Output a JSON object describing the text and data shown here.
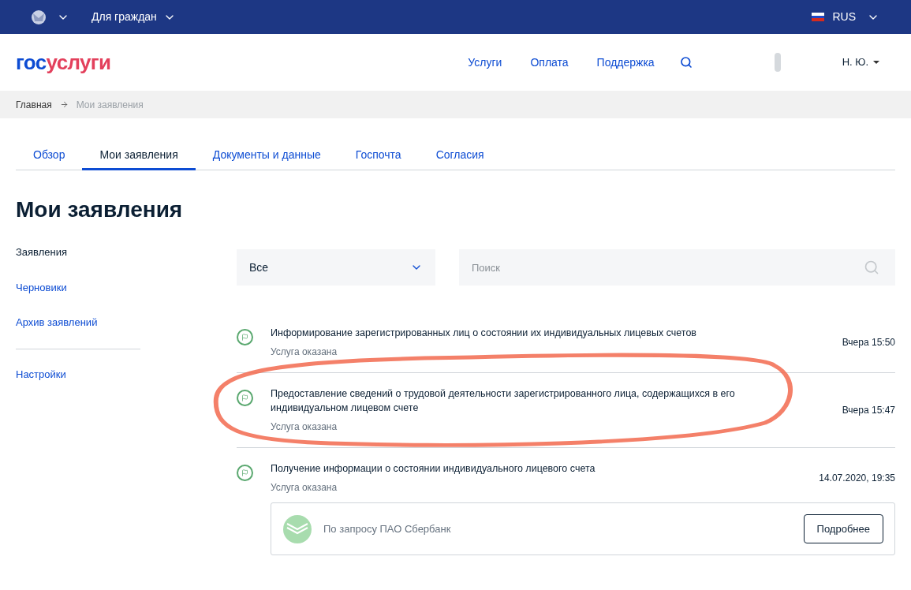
{
  "top_bar": {
    "audience": "Для граждан",
    "language": "RUS"
  },
  "header": {
    "logo": {
      "prefix": "гос",
      "suffix": "услуги"
    },
    "nav": [
      "Услуги",
      "Оплата",
      "Поддержка"
    ],
    "user": "Н. Ю."
  },
  "breadcrumbs": [
    {
      "label": "Главная"
    },
    {
      "label": "Мои заявления"
    }
  ],
  "tabs": [
    {
      "label": "Обзор",
      "selected": false
    },
    {
      "label": "Мои заявления",
      "selected": true
    },
    {
      "label": "Документы и данные",
      "selected": false
    },
    {
      "label": "Госпочта",
      "selected": false
    },
    {
      "label": "Согласия",
      "selected": false
    }
  ],
  "page_title": "Мои заявления",
  "sidebar": {
    "items": [
      {
        "label": "Заявления"
      },
      {
        "label": "Черновики"
      },
      {
        "label": "Архив заявлений"
      }
    ],
    "bottom_items": [
      {
        "label": "Настройки"
      }
    ]
  },
  "filter": {
    "value": "Все"
  },
  "search": {
    "placeholder": "Поиск"
  },
  "applications": [
    {
      "title": "Информирование зарегистрированных лиц о состоянии их индивидуальных лицевых счетов",
      "status": "Услуга оказана",
      "time": "Вчера 15:50",
      "highlighted": false
    },
    {
      "title": "Предоставление сведений о трудовой деятельности зарегистрированного лица, содержащихся в его индивидуальном лицевом счете",
      "status": "Услуга оказана",
      "time": "Вчера 15:47",
      "highlighted": true
    },
    {
      "title": "Получение информации о состоянии индивидуального лицевого счета",
      "status": "Услуга оказана",
      "time": "14.07.2020, 19:35",
      "highlighted": false,
      "attachment": {
        "text": "По запросу ПАО Сбербанк",
        "button": "Подробнее"
      }
    }
  ]
}
